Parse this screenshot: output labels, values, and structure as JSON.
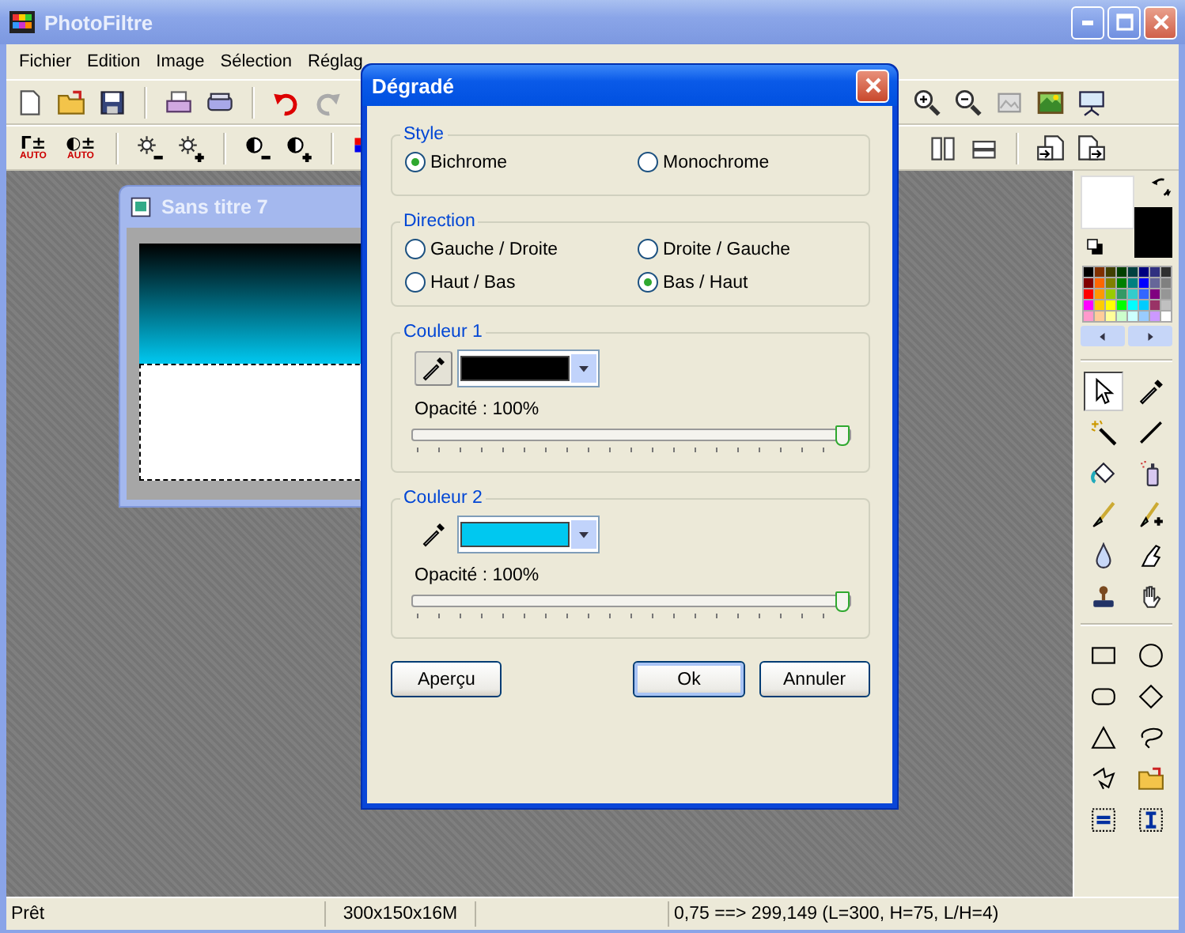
{
  "window": {
    "title": "PhotoFiltre"
  },
  "menu": [
    "Fichier",
    "Edition",
    "Image",
    "Sélection",
    "Réglag"
  ],
  "auto_buttons": [
    {
      "symbol": "Γ±",
      "caption": "AUTO"
    },
    {
      "symbol": "◐±",
      "caption": "AUTO"
    }
  ],
  "document": {
    "title": "Sans titre 7"
  },
  "toolbox": {
    "swatches": [
      {
        "color": "#ffffff"
      },
      {
        "color": "#000000"
      }
    ],
    "palette": [
      {
        "color": "#000000"
      },
      {
        "color": "#803000"
      },
      {
        "color": "#404000"
      },
      {
        "color": "#004000"
      },
      {
        "color": "#004040"
      },
      {
        "color": "#000080"
      },
      {
        "color": "#303080"
      },
      {
        "color": "#303030"
      },
      {
        "color": "#800000"
      },
      {
        "color": "#ff6600"
      },
      {
        "color": "#808000"
      },
      {
        "color": "#008000"
      },
      {
        "color": "#008080"
      },
      {
        "color": "#0000ff"
      },
      {
        "color": "#666699"
      },
      {
        "color": "#808080"
      },
      {
        "color": "#ff0000"
      },
      {
        "color": "#ff9900"
      },
      {
        "color": "#99cc00"
      },
      {
        "color": "#339966"
      },
      {
        "color": "#33cccc"
      },
      {
        "color": "#3366ff"
      },
      {
        "color": "#800080"
      },
      {
        "color": "#969696"
      },
      {
        "color": "#ff00ff"
      },
      {
        "color": "#ffcc00"
      },
      {
        "color": "#ffff00"
      },
      {
        "color": "#00ff00"
      },
      {
        "color": "#00ffff"
      },
      {
        "color": "#00ccff"
      },
      {
        "color": "#993366"
      },
      {
        "color": "#c0c0c0"
      },
      {
        "color": "#ff99cc"
      },
      {
        "color": "#ffcc99"
      },
      {
        "color": "#ffff99"
      },
      {
        "color": "#ccffcc"
      },
      {
        "color": "#ccffff"
      },
      {
        "color": "#99ccff"
      },
      {
        "color": "#cc99ff"
      },
      {
        "color": "#ffffff"
      }
    ],
    "tools": [
      {
        "selected": true
      },
      {
        "selected": false
      },
      {
        "selected": false
      },
      {
        "selected": false
      },
      {
        "selected": false
      },
      {
        "selected": false
      },
      {
        "selected": false
      },
      {
        "selected": false
      },
      {
        "selected": false
      },
      {
        "selected": false
      },
      {
        "selected": false
      },
      {
        "selected": false
      },
      {
        "selected": false
      },
      {
        "selected": false
      },
      {
        "selected": false
      },
      {
        "selected": false
      },
      {
        "selected": false
      },
      {
        "selected": false
      },
      {
        "selected": false
      },
      {
        "selected": false
      },
      {
        "selected": false
      },
      {
        "selected": false
      }
    ]
  },
  "dialog": {
    "title": "Dégradé",
    "style": {
      "label": "Style",
      "options": [
        {
          "label": "Bichrome",
          "selected": true
        },
        {
          "label": "Monochrome",
          "selected": false
        }
      ]
    },
    "direction": {
      "label": "Direction",
      "options": [
        {
          "label": "Gauche / Droite",
          "selected": false
        },
        {
          "label": "Droite / Gauche",
          "selected": false
        },
        {
          "label": "Haut / Bas",
          "selected": false
        },
        {
          "label": "Bas / Haut",
          "selected": true
        }
      ]
    },
    "colors": [
      {
        "label": "Couleur 1",
        "color": "#000000",
        "picker_raised": true,
        "opacity": "Opacité : 100%",
        "level": 1
      },
      {
        "label": "Couleur 2",
        "color": "#00c8f0",
        "picker_raised": false,
        "opacity": "Opacité : 100%",
        "level": 1
      }
    ],
    "buttons": [
      {
        "label": "Aperçu",
        "default": false
      },
      {
        "label": "Ok",
        "default": true
      },
      {
        "label": "Annuler",
        "default": false
      }
    ]
  },
  "status_bar": [
    "Prêt",
    "300x150x16M",
    "0,75 ==> 299,149 (L=300, H=75, L/H=4)"
  ]
}
